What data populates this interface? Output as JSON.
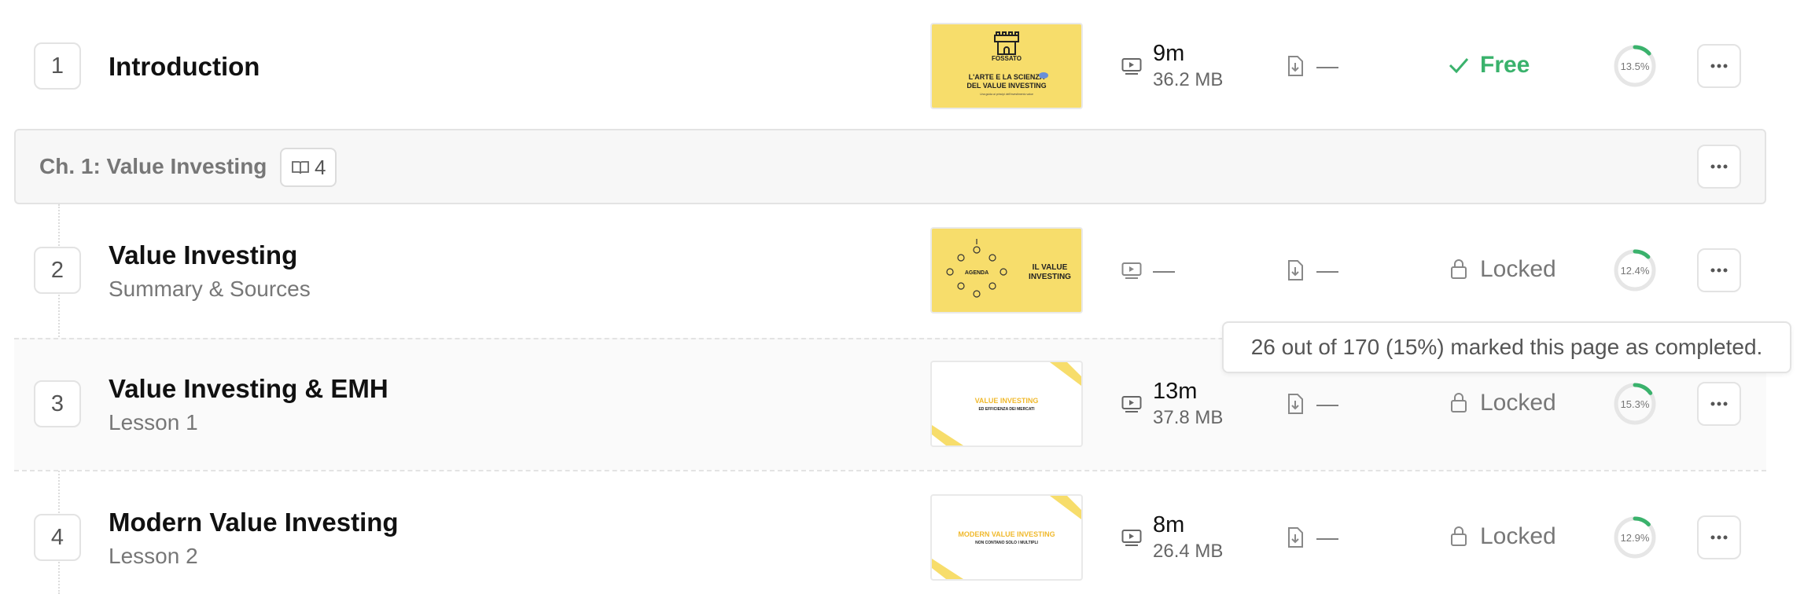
{
  "colors": {
    "accent_green": "#3ab26c",
    "ring_track": "#e6e6e6",
    "thumb_yellow": "#f7dd6b"
  },
  "lessons": [
    {
      "number": "1",
      "title": "Introduction",
      "subtitle": "",
      "duration": "9m",
      "size": "36.2 MB",
      "download": "—",
      "status": "Free",
      "status_icon": "check-icon",
      "progress": "13.5%",
      "progress_value": 0.135,
      "thumb": {
        "style": "yellow",
        "logo_text": "FOSSATO",
        "line1": "L'ARTE E LA SCIENZA",
        "line2": "DEL VALUE INVESTING",
        "line3": "Una guida ai principi dell'investimento value"
      }
    },
    {
      "number": "2",
      "title": "Value Investing",
      "subtitle": "Summary & Sources",
      "duration": "—",
      "size": "",
      "download": "—",
      "status": "Locked",
      "status_icon": "lock-icon",
      "progress": "12.4%",
      "progress_value": 0.124,
      "thumb": {
        "style": "yellow",
        "center_text": "AGENDA",
        "side1": "IL VALUE",
        "side2": "INVESTING"
      }
    },
    {
      "number": "3",
      "title": "Value Investing & EMH",
      "subtitle": "Lesson 1",
      "duration": "13m",
      "size": "37.8 MB",
      "download": "—",
      "status": "Locked",
      "status_icon": "lock-icon",
      "progress": "15.3%",
      "progress_value": 0.153,
      "thumb": {
        "style": "white",
        "line1": "VALUE INVESTING",
        "line2": "ED EFFICIENZA DEI MERCATI"
      }
    },
    {
      "number": "4",
      "title": "Modern Value Investing",
      "subtitle": "Lesson 2",
      "duration": "8m",
      "size": "26.4 MB",
      "download": "—",
      "status": "Locked",
      "status_icon": "lock-icon",
      "progress": "12.9%",
      "progress_value": 0.129,
      "thumb": {
        "style": "white",
        "line1": "MODERN VALUE INVESTING",
        "line2": "NON CONTANO SOLO I MULTIPLI"
      }
    }
  ],
  "chapter": {
    "title": "Ch. 1: Value Investing",
    "count": "4",
    "icon": "book-icon"
  },
  "tooltip": {
    "text": "26 out of 170 (15%) marked this page as completed."
  },
  "icons": {
    "video": "video-icon",
    "download": "file-download-icon",
    "more": "more-horizontal-icon"
  }
}
